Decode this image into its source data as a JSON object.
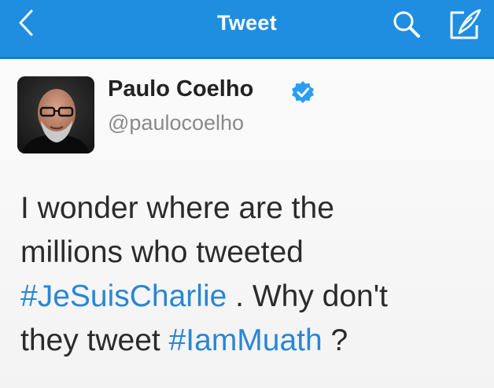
{
  "navbar": {
    "title": "Tweet",
    "back_icon": "chevron-left-icon",
    "search_icon": "search-icon",
    "compose_icon": "compose-icon",
    "background_color": "#1f8ee0"
  },
  "tweet": {
    "author": {
      "name": "Paulo Coelho",
      "handle": "@paulocoelho",
      "verified": true,
      "verified_color": "#2a9df4"
    },
    "text_lines": [
      {
        "parts": [
          {
            "text": "I wonder where are the",
            "hashtag": false
          }
        ]
      },
      {
        "parts": [
          {
            "text": "millions who tweeted",
            "hashtag": false
          }
        ]
      },
      {
        "parts": [
          {
            "text": "#JeSuisCharlie",
            "hashtag": true
          },
          {
            "text": " . Why  don't",
            "hashtag": false
          }
        ]
      },
      {
        "parts": [
          {
            "text": "they tweet ",
            "hashtag": false
          },
          {
            "text": "#IamMuath",
            "hashtag": true
          },
          {
            "text": " ?",
            "hashtag": false
          }
        ]
      }
    ],
    "hashtag_color": "#2a86d4"
  }
}
